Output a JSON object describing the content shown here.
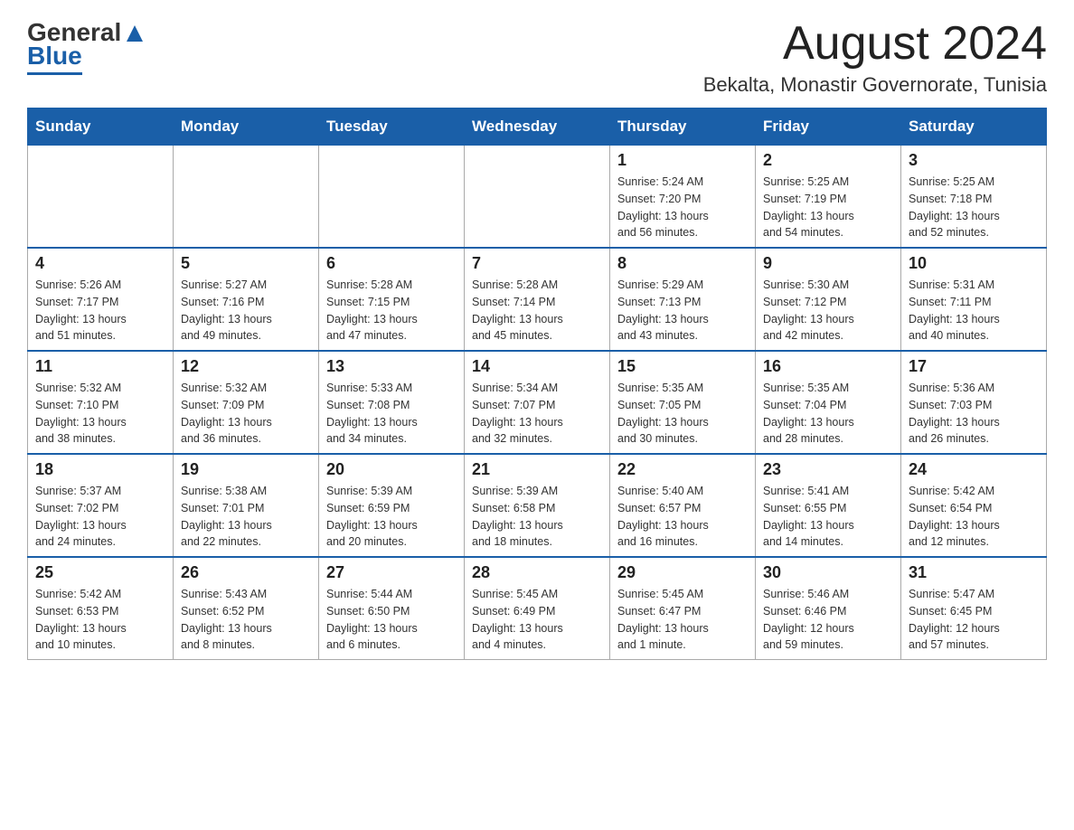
{
  "logo": {
    "general": "General",
    "blue": "Blue"
  },
  "header": {
    "month_year": "August 2024",
    "location": "Bekalta, Monastir Governorate, Tunisia"
  },
  "days_of_week": [
    "Sunday",
    "Monday",
    "Tuesday",
    "Wednesday",
    "Thursday",
    "Friday",
    "Saturday"
  ],
  "weeks": [
    {
      "days": [
        {
          "number": "",
          "info": ""
        },
        {
          "number": "",
          "info": ""
        },
        {
          "number": "",
          "info": ""
        },
        {
          "number": "",
          "info": ""
        },
        {
          "number": "1",
          "info": "Sunrise: 5:24 AM\nSunset: 7:20 PM\nDaylight: 13 hours\nand 56 minutes."
        },
        {
          "number": "2",
          "info": "Sunrise: 5:25 AM\nSunset: 7:19 PM\nDaylight: 13 hours\nand 54 minutes."
        },
        {
          "number": "3",
          "info": "Sunrise: 5:25 AM\nSunset: 7:18 PM\nDaylight: 13 hours\nand 52 minutes."
        }
      ]
    },
    {
      "days": [
        {
          "number": "4",
          "info": "Sunrise: 5:26 AM\nSunset: 7:17 PM\nDaylight: 13 hours\nand 51 minutes."
        },
        {
          "number": "5",
          "info": "Sunrise: 5:27 AM\nSunset: 7:16 PM\nDaylight: 13 hours\nand 49 minutes."
        },
        {
          "number": "6",
          "info": "Sunrise: 5:28 AM\nSunset: 7:15 PM\nDaylight: 13 hours\nand 47 minutes."
        },
        {
          "number": "7",
          "info": "Sunrise: 5:28 AM\nSunset: 7:14 PM\nDaylight: 13 hours\nand 45 minutes."
        },
        {
          "number": "8",
          "info": "Sunrise: 5:29 AM\nSunset: 7:13 PM\nDaylight: 13 hours\nand 43 minutes."
        },
        {
          "number": "9",
          "info": "Sunrise: 5:30 AM\nSunset: 7:12 PM\nDaylight: 13 hours\nand 42 minutes."
        },
        {
          "number": "10",
          "info": "Sunrise: 5:31 AM\nSunset: 7:11 PM\nDaylight: 13 hours\nand 40 minutes."
        }
      ]
    },
    {
      "days": [
        {
          "number": "11",
          "info": "Sunrise: 5:32 AM\nSunset: 7:10 PM\nDaylight: 13 hours\nand 38 minutes."
        },
        {
          "number": "12",
          "info": "Sunrise: 5:32 AM\nSunset: 7:09 PM\nDaylight: 13 hours\nand 36 minutes."
        },
        {
          "number": "13",
          "info": "Sunrise: 5:33 AM\nSunset: 7:08 PM\nDaylight: 13 hours\nand 34 minutes."
        },
        {
          "number": "14",
          "info": "Sunrise: 5:34 AM\nSunset: 7:07 PM\nDaylight: 13 hours\nand 32 minutes."
        },
        {
          "number": "15",
          "info": "Sunrise: 5:35 AM\nSunset: 7:05 PM\nDaylight: 13 hours\nand 30 minutes."
        },
        {
          "number": "16",
          "info": "Sunrise: 5:35 AM\nSunset: 7:04 PM\nDaylight: 13 hours\nand 28 minutes."
        },
        {
          "number": "17",
          "info": "Sunrise: 5:36 AM\nSunset: 7:03 PM\nDaylight: 13 hours\nand 26 minutes."
        }
      ]
    },
    {
      "days": [
        {
          "number": "18",
          "info": "Sunrise: 5:37 AM\nSunset: 7:02 PM\nDaylight: 13 hours\nand 24 minutes."
        },
        {
          "number": "19",
          "info": "Sunrise: 5:38 AM\nSunset: 7:01 PM\nDaylight: 13 hours\nand 22 minutes."
        },
        {
          "number": "20",
          "info": "Sunrise: 5:39 AM\nSunset: 6:59 PM\nDaylight: 13 hours\nand 20 minutes."
        },
        {
          "number": "21",
          "info": "Sunrise: 5:39 AM\nSunset: 6:58 PM\nDaylight: 13 hours\nand 18 minutes."
        },
        {
          "number": "22",
          "info": "Sunrise: 5:40 AM\nSunset: 6:57 PM\nDaylight: 13 hours\nand 16 minutes."
        },
        {
          "number": "23",
          "info": "Sunrise: 5:41 AM\nSunset: 6:55 PM\nDaylight: 13 hours\nand 14 minutes."
        },
        {
          "number": "24",
          "info": "Sunrise: 5:42 AM\nSunset: 6:54 PM\nDaylight: 13 hours\nand 12 minutes."
        }
      ]
    },
    {
      "days": [
        {
          "number": "25",
          "info": "Sunrise: 5:42 AM\nSunset: 6:53 PM\nDaylight: 13 hours\nand 10 minutes."
        },
        {
          "number": "26",
          "info": "Sunrise: 5:43 AM\nSunset: 6:52 PM\nDaylight: 13 hours\nand 8 minutes."
        },
        {
          "number": "27",
          "info": "Sunrise: 5:44 AM\nSunset: 6:50 PM\nDaylight: 13 hours\nand 6 minutes."
        },
        {
          "number": "28",
          "info": "Sunrise: 5:45 AM\nSunset: 6:49 PM\nDaylight: 13 hours\nand 4 minutes."
        },
        {
          "number": "29",
          "info": "Sunrise: 5:45 AM\nSunset: 6:47 PM\nDaylight: 13 hours\nand 1 minute."
        },
        {
          "number": "30",
          "info": "Sunrise: 5:46 AM\nSunset: 6:46 PM\nDaylight: 12 hours\nand 59 minutes."
        },
        {
          "number": "31",
          "info": "Sunrise: 5:47 AM\nSunset: 6:45 PM\nDaylight: 12 hours\nand 57 minutes."
        }
      ]
    }
  ]
}
